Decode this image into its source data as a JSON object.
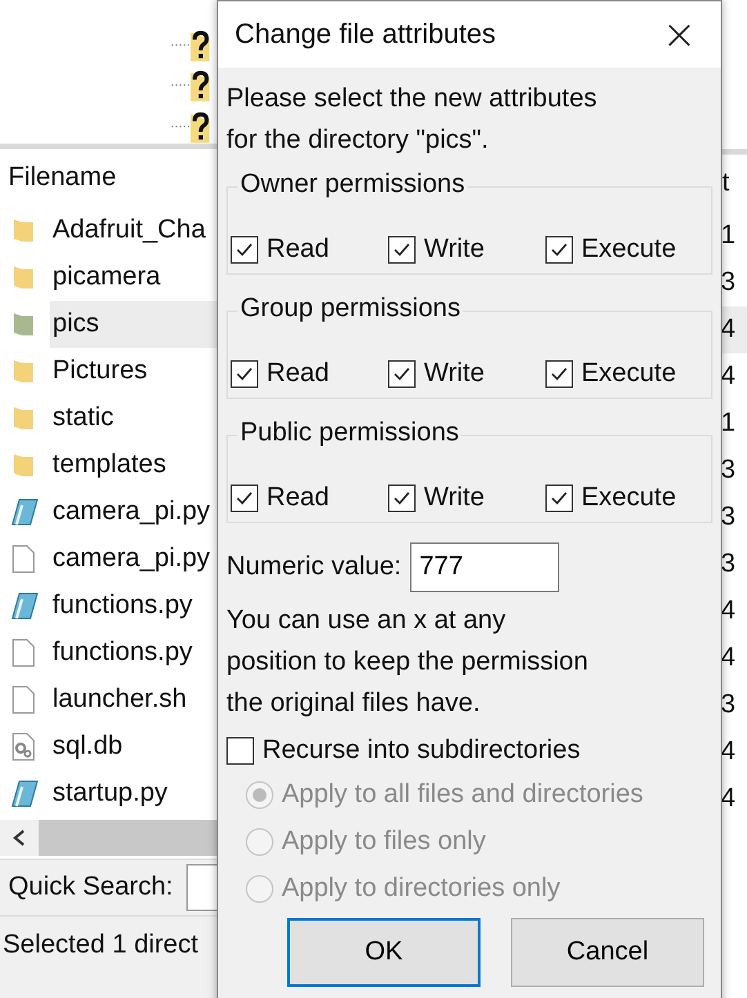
{
  "file_list": {
    "columns": [
      "Filename",
      "t"
    ],
    "rows": [
      {
        "name": "Adafruit_Cha",
        "kind": "folder",
        "selected": false,
        "column_2": "1"
      },
      {
        "name": "picamera",
        "kind": "folder",
        "selected": false,
        "column_2": "3"
      },
      {
        "name": "pics",
        "kind": "folder",
        "selected": true,
        "column_2": "4"
      },
      {
        "name": "Pictures",
        "kind": "folder",
        "selected": false,
        "column_2": "4"
      },
      {
        "name": "static",
        "kind": "folder",
        "selected": false,
        "column_2": "1"
      },
      {
        "name": "templates",
        "kind": "folder",
        "selected": false,
        "column_2": "3"
      },
      {
        "name": "camera_pi.py",
        "kind": "script",
        "selected": false,
        "column_2": "3"
      },
      {
        "name": "camera_pi.py",
        "kind": "file",
        "selected": false,
        "column_2": "3"
      },
      {
        "name": "functions.py",
        "kind": "script",
        "selected": false,
        "column_2": "4"
      },
      {
        "name": "functions.py",
        "kind": "file",
        "selected": false,
        "column_2": "4"
      },
      {
        "name": "launcher.sh",
        "kind": "file",
        "selected": false,
        "column_2": "3"
      },
      {
        "name": "sql.db",
        "kind": "database",
        "selected": false,
        "column_2": "4"
      },
      {
        "name": "startup.py",
        "kind": "script",
        "selected": false,
        "column_2": "4"
      }
    ]
  },
  "quick_search": {
    "label": "Quick Search:"
  },
  "status_bar": "Selected 1 direct",
  "dialog": {
    "title": "Change file attributes",
    "close": "×",
    "message": "Please select the new attributes\nfor the directory \"pics\".",
    "groups": [
      {
        "legend": "Owner permissions",
        "permissions": [
          {
            "label": "Read",
            "checked": true
          },
          {
            "label": "Write",
            "checked": true
          },
          {
            "label": "Execute",
            "checked": true
          }
        ]
      },
      {
        "legend": "Group permissions",
        "permissions": [
          {
            "label": "Read",
            "checked": true
          },
          {
            "label": "Write",
            "checked": true
          },
          {
            "label": "Execute",
            "checked": true
          }
        ]
      },
      {
        "legend": "Public permissions",
        "permissions": [
          {
            "label": "Read",
            "checked": true
          },
          {
            "label": "Write",
            "checked": true
          },
          {
            "label": "Execute",
            "checked": true
          }
        ]
      }
    ],
    "numeric": {
      "label": "Numeric value:",
      "value": "777"
    },
    "note": "You can use an x at any\nposition to keep the permission\nthe original files have.",
    "recurse": {
      "label": "Recurse into subdirectories",
      "checked": false
    },
    "options": [
      {
        "label": "Apply to all files and directories",
        "selected": true,
        "disabled": true
      },
      {
        "label": "Apply to files only",
        "selected": false,
        "disabled": true
      },
      {
        "label": "Apply to directories only",
        "selected": false,
        "disabled": true
      }
    ],
    "buttons": [
      {
        "label": "OK",
        "default": true
      },
      {
        "label": "Cancel",
        "default": false
      }
    ]
  }
}
